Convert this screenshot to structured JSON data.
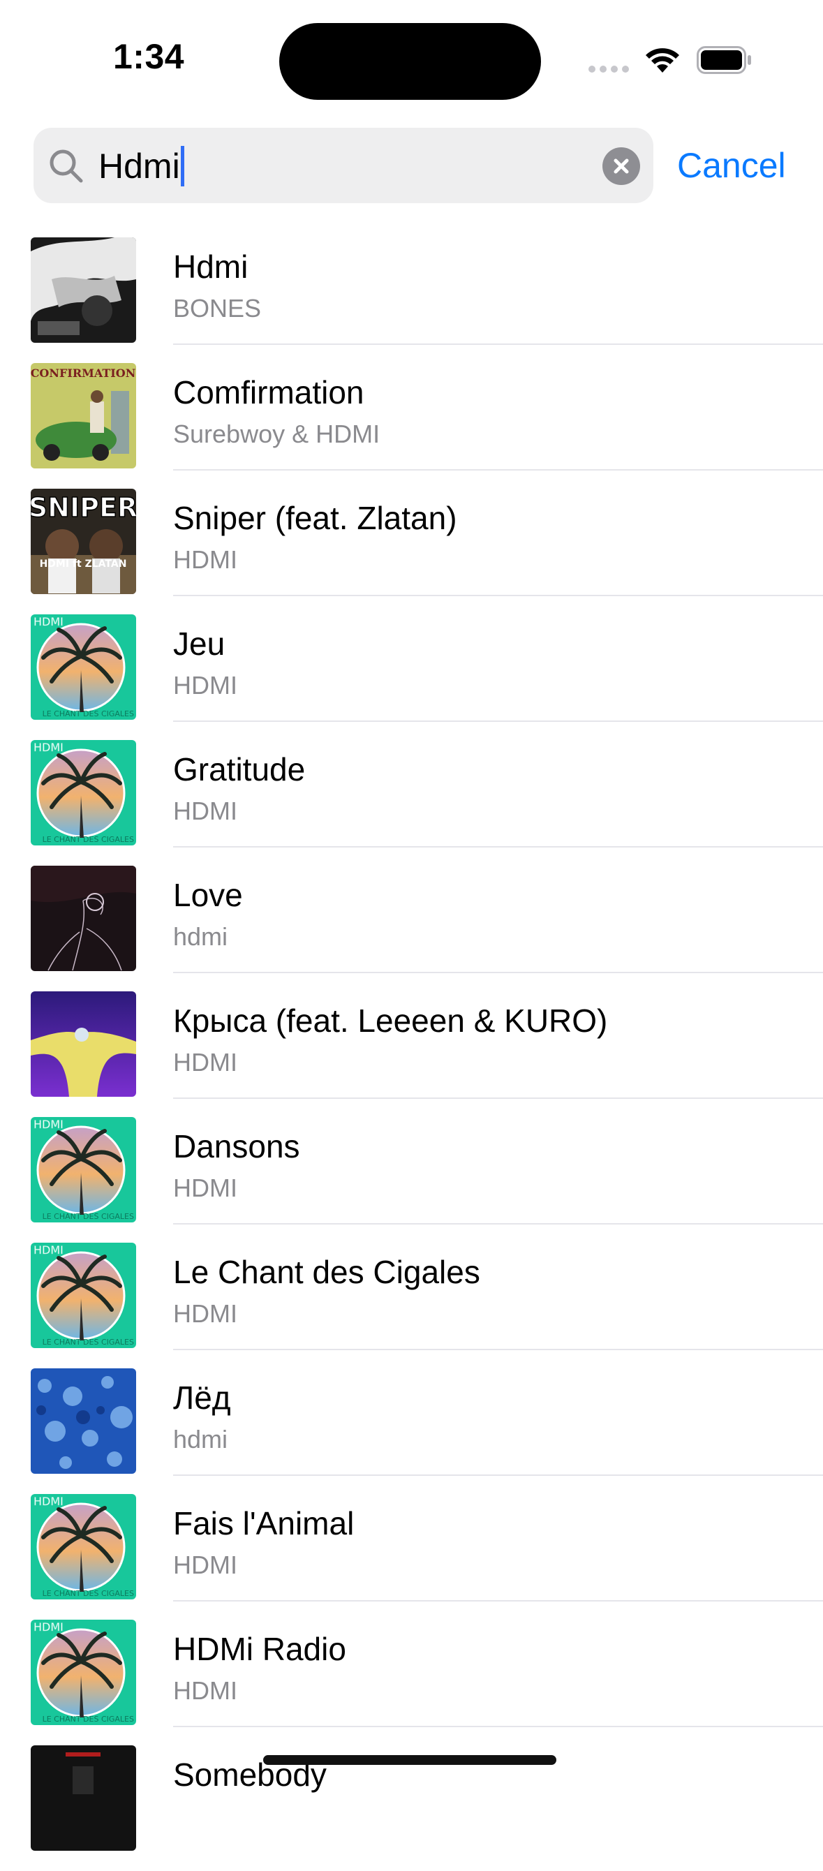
{
  "status_bar": {
    "time": "1:34"
  },
  "search": {
    "query": "Hdmi",
    "cancel_label": "Cancel"
  },
  "results": [
    {
      "title": "Hdmi",
      "artist": "BONES",
      "art": "bw"
    },
    {
      "title": "Comfirmation",
      "artist": "Surebwoy & HDMI",
      "art": "confirmation"
    },
    {
      "title": "Sniper (feat. Zlatan)",
      "artist": "HDMI",
      "art": "sniper"
    },
    {
      "title": "Jeu",
      "artist": "HDMI",
      "art": "palm"
    },
    {
      "title": "Gratitude",
      "artist": "HDMI",
      "art": "palm"
    },
    {
      "title": "Love",
      "artist": "hdmi",
      "art": "dark"
    },
    {
      "title": "Крыса (feat. Leeeen & KURO)",
      "artist": "HDMI",
      "art": "purple"
    },
    {
      "title": "Dansons",
      "artist": "HDMI",
      "art": "palm"
    },
    {
      "title": "Le Chant des Cigales",
      "artist": "HDMI",
      "art": "palm"
    },
    {
      "title": "Лёд",
      "artist": "hdmi",
      "art": "blue"
    },
    {
      "title": "Fais l'Animal",
      "artist": "HDMI",
      "art": "palm"
    },
    {
      "title": "HDMi Radio",
      "artist": "HDMI",
      "art": "palm"
    },
    {
      "title": "Somebody",
      "artist": "",
      "art": "darkred"
    }
  ],
  "art_text": {
    "palm_logo": "HDMI",
    "palm_caption": "LE CHANT DES CIGALES",
    "confirmation": "CONFIRMATION",
    "sniper_title": "SNIPER",
    "sniper_names": "HDMI ft ZLATAN"
  },
  "colors": {
    "accent": "#0a7aff",
    "palm_bg": "#18c79b"
  }
}
